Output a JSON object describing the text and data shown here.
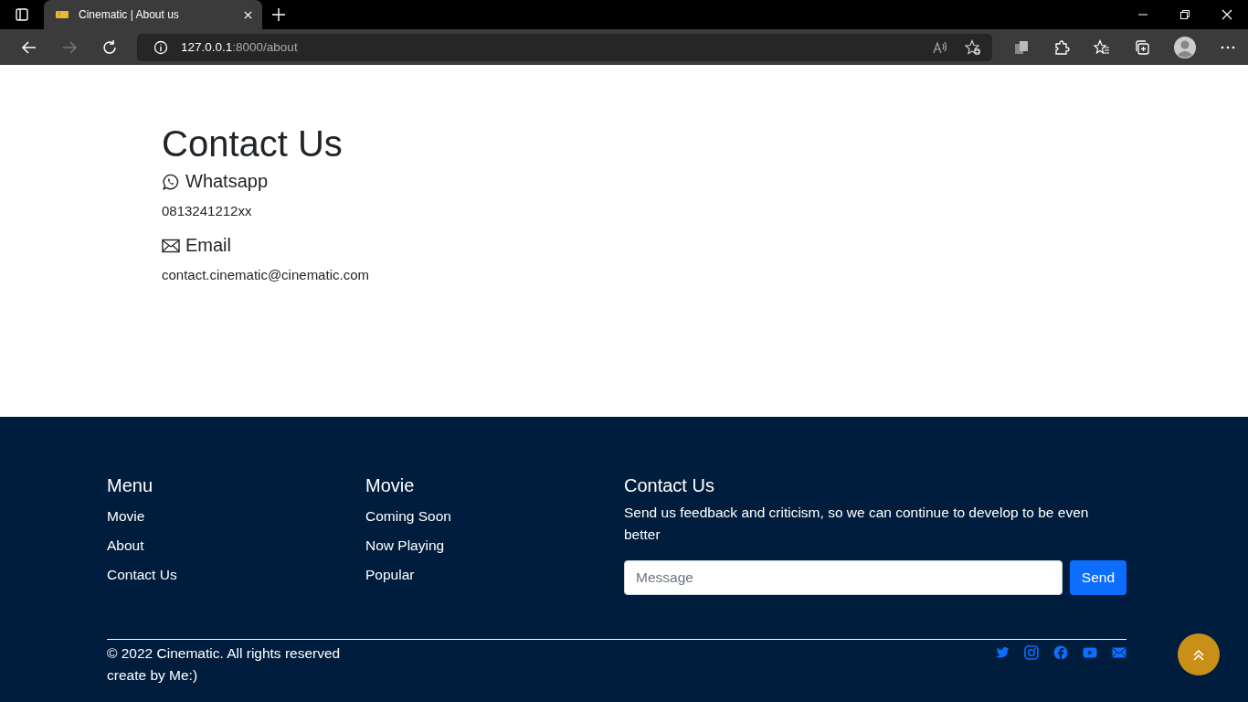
{
  "browser": {
    "tab_title": "Cinematic | About us",
    "url_host": "127.0.0.1",
    "url_path": ":8000/about"
  },
  "contact": {
    "title": "Contact Us",
    "items": [
      {
        "kind": "whatsapp",
        "label": "Whatsapp",
        "value": "0813241212xx"
      },
      {
        "kind": "email",
        "label": "Email",
        "value": "contact.cinematic@cinematic.com"
      }
    ]
  },
  "footer": {
    "columns": [
      {
        "title": "Menu",
        "links": [
          "Movie",
          "About",
          "Contact Us"
        ]
      },
      {
        "title": "Movie",
        "links": [
          "Coming Soon",
          "Now Playing",
          "Popular"
        ]
      }
    ],
    "contact": {
      "title": "Contact Us",
      "text": "Send us feedback and criticism, so we can continue to develop to be even better",
      "placeholder": "Message",
      "button": "Send"
    },
    "copyright": "© 2022 Cinematic. All rights reserved",
    "credit": "create by Me:)",
    "socials": [
      {
        "kind": "twitter"
      },
      {
        "kind": "instagram"
      },
      {
        "kind": "facebook"
      },
      {
        "kind": "youtube"
      },
      {
        "kind": "email"
      }
    ]
  }
}
